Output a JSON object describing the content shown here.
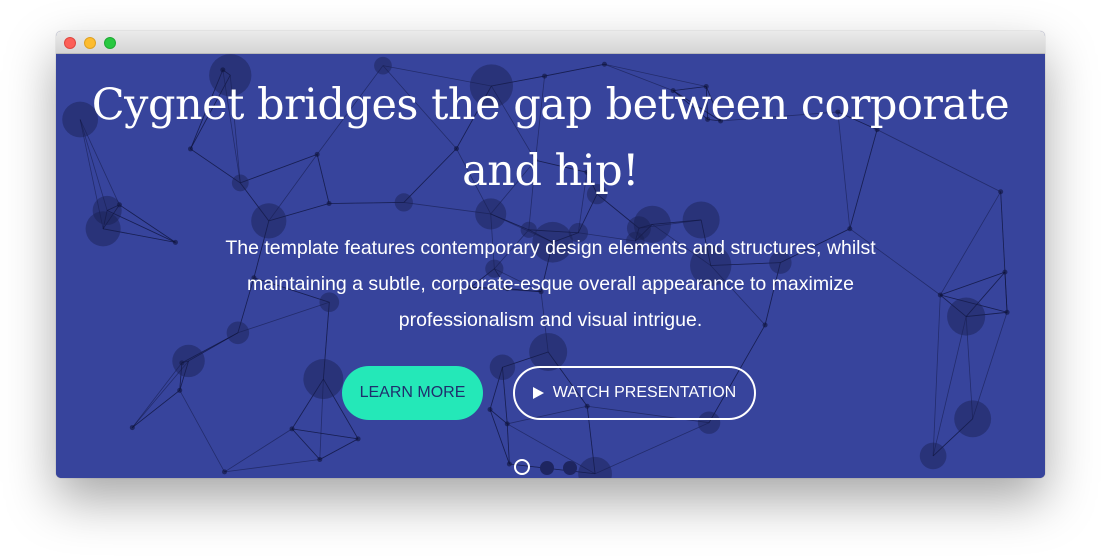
{
  "window": {
    "controls": [
      "close-icon",
      "minimize-icon",
      "maximize-icon"
    ]
  },
  "hero": {
    "headline_line1": "Cygnet bridges the gap between corporate",
    "headline_line2": "and hip!",
    "subtitle_line1": "The template features contemporary design elements and structures, whilst",
    "subtitle_line2": "maintaining a subtle, corporate-esque overall appearance to maximize",
    "subtitle_line3": "professionalism and visual intrigue.",
    "primary_button": "LEARN MORE",
    "secondary_button": "WATCH PRESENTATION",
    "secondary_icon": "play-icon",
    "slides_total": 3,
    "active_slide": 1
  },
  "colors": {
    "background": "#37449c",
    "accent": "#24e8b8",
    "accent_text": "#1f2f6d",
    "text": "#ffffff",
    "dot_inactive": "#1e2560"
  }
}
